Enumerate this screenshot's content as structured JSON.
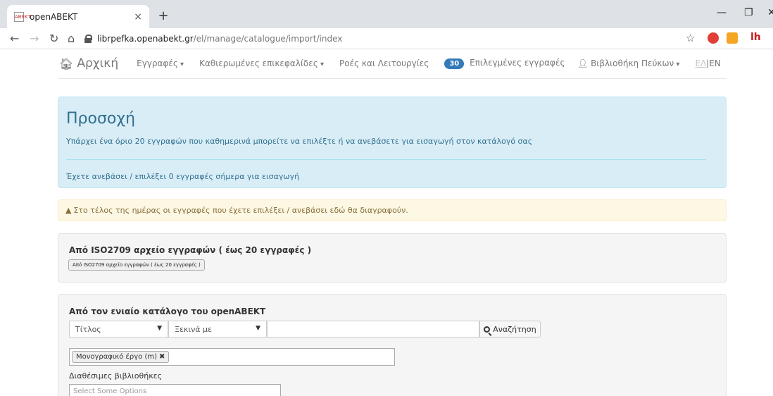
{
  "browser": {
    "tab_title": "openABEKT",
    "tab_favicon": "ΑΒΕΚΤ",
    "url_host": "librpefka.openabekt.gr",
    "url_path": "/el/manage/catalogue/import/index",
    "colors": {
      "tabbar": "#dee1e6",
      "ext_red": "#e03e36",
      "ext_orange": "#f5a623",
      "ext_dark": "#c41e1e"
    }
  },
  "nav": {
    "home": "Αρχική",
    "records": "Εγγραφές",
    "headings": "Καθιερωμένες επικεφαλίδες",
    "flows": "Ροές και Λειτουργίες",
    "selected_count": "30",
    "selected_label": "Επιλεγμένες εγγραφές",
    "library": "Βιβλιοθήκη Πεύκων",
    "lang_el": "ΕΛ",
    "lang_sep": "|",
    "lang_en": "EN"
  },
  "alert_info": {
    "title": "Προσοχή",
    "line1": "Υπάρχει ένα όριο 20 εγγραφών που καθημερινά μπορείτε να επιλέξτε ή να ανεβάσετε για εισαγωγή στον κατάλογό σας",
    "line2": "Έχετε ανεβάσει / επιλέξει 0 εγγραφές σήμερα για εισαγωγή"
  },
  "alert_warning": {
    "text": "Στο τέλος της ημέρας οι εγγραφές που έχετε επιλέξει / ανεβάσει εδώ θα διαγραφούν."
  },
  "iso_section": {
    "heading": "Από ISO2709 αρχείο εγγραφών ( έως 20 εγγραφές )",
    "button": "Από ISO2709 αρχείο εγγραφών ( έως 20 εγγραφές )"
  },
  "catalog_section": {
    "heading": "Από τον ενιαίο κατάλογο του openABEKT",
    "field_select": "Τίτλος",
    "match_select": "Ξεκινά με",
    "search_value": "",
    "search_button": "Αναζήτηση",
    "chip": "Μονογραφικό έργο (m)",
    "libraries_label": "Διαθέσιμες βιβλιοθήκες",
    "libraries_placeholder": "Select Some Options"
  }
}
